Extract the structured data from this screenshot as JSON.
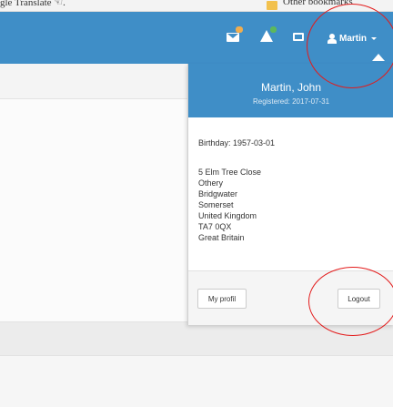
{
  "browser": {
    "bookmark_left": "gle Translate  ☜.",
    "bookmark_right": "Other bookmarks"
  },
  "navbar": {
    "icons": [
      "mail-icon",
      "alert-icon",
      "money-icon",
      "user-icon",
      "chevron-down-icon"
    ],
    "user_label": "Martin",
    "bg_color": "#3f8ec7"
  },
  "profile": {
    "name": "Martin, John",
    "registered": "Registered: 2017-07-31",
    "birthday": "Birthday: 1957-03-01",
    "address": [
      "5 Elm Tree Close",
      "Othery",
      "Bridgwater",
      "Somerset",
      "United Kingdom",
      "TA7 0QX",
      "Great Britain"
    ],
    "my_profile_label": "My profil",
    "logout_label": "Logout"
  },
  "annotation_color": "#e31b1b"
}
